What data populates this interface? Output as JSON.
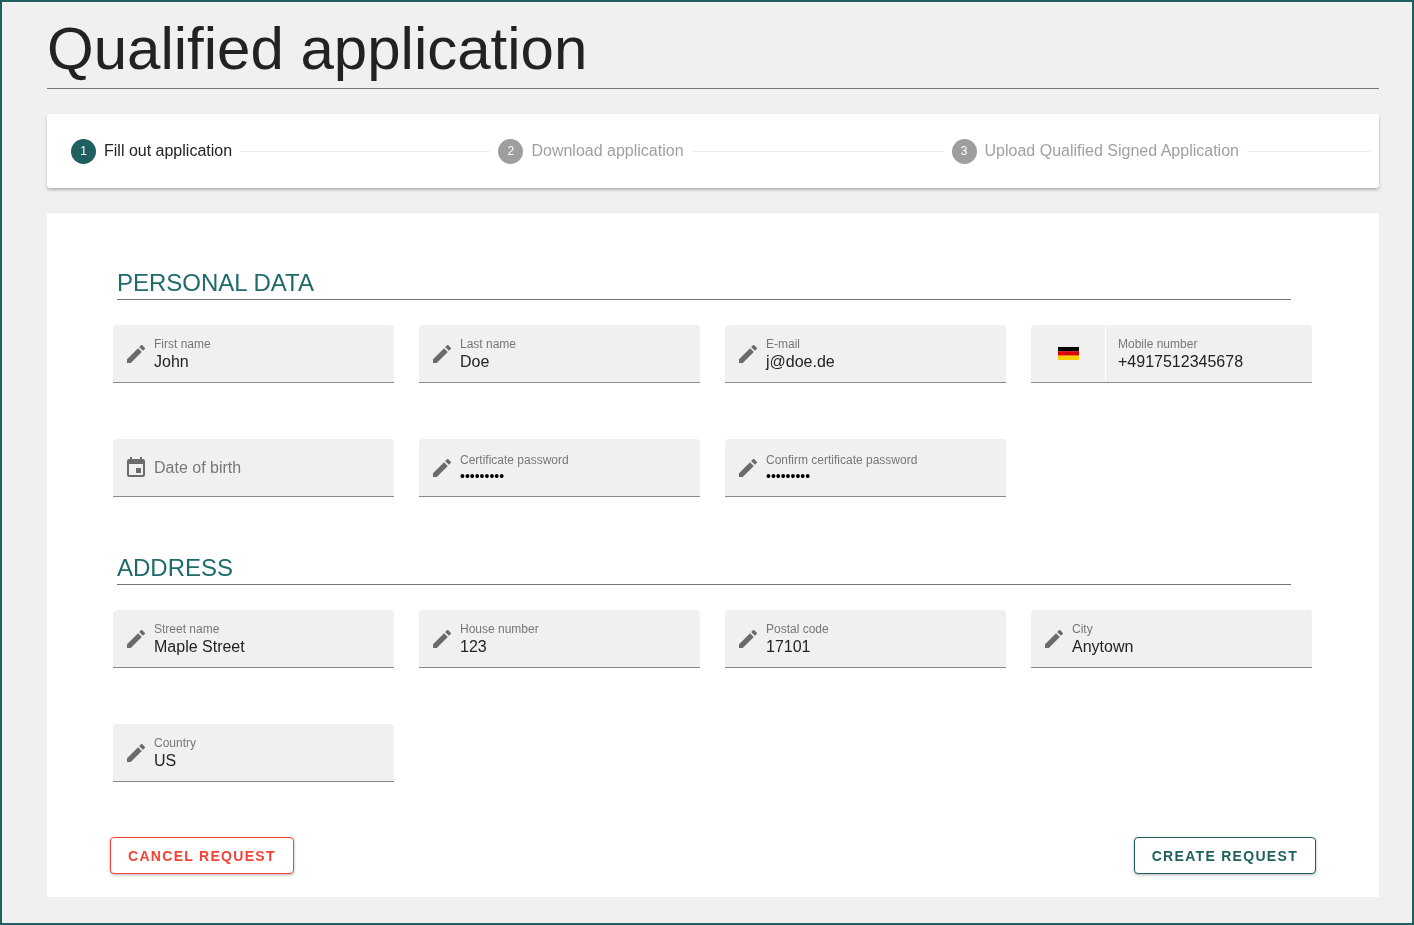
{
  "title": "Qualified application",
  "steps": [
    {
      "number": "1",
      "label": "Fill out application",
      "selected": true
    },
    {
      "number": "2",
      "label": "Download application",
      "selected": false
    },
    {
      "number": "3",
      "label": "Upload Qualified Signed Application",
      "selected": false
    }
  ],
  "sections": [
    {
      "title": "PERSONAL DATA",
      "fields": [
        {
          "kind": "text",
          "label": "First name",
          "value": "John"
        },
        {
          "kind": "text",
          "label": "Last name",
          "value": "Doe"
        },
        {
          "kind": "text",
          "label": "E-mail",
          "value": "j@doe.de"
        },
        {
          "kind": "phone",
          "label": "Mobile number",
          "value": "+4917512345678"
        },
        {
          "kind": "date",
          "placeholder": "Date of birth"
        },
        {
          "kind": "password",
          "label": "Certificate password",
          "value": "•••••••••"
        },
        {
          "kind": "password",
          "label": "Confirm certificate password",
          "value": "•••••••••"
        }
      ]
    },
    {
      "title": "ADDRESS",
      "fields": [
        {
          "kind": "text",
          "label": "Street name",
          "value": "Maple Street"
        },
        {
          "kind": "text",
          "label": "House number",
          "value": "123"
        },
        {
          "kind": "text",
          "label": "Postal code",
          "value": "17101"
        },
        {
          "kind": "text",
          "label": "City",
          "value": "Anytown"
        },
        {
          "kind": "text",
          "label": "Country",
          "value": "US"
        }
      ]
    }
  ],
  "buttons": [
    {
      "kind": "cancel",
      "label": "CANCEL REQUEST"
    },
    {
      "kind": "create",
      "label": "CREATE REQUEST"
    }
  ]
}
